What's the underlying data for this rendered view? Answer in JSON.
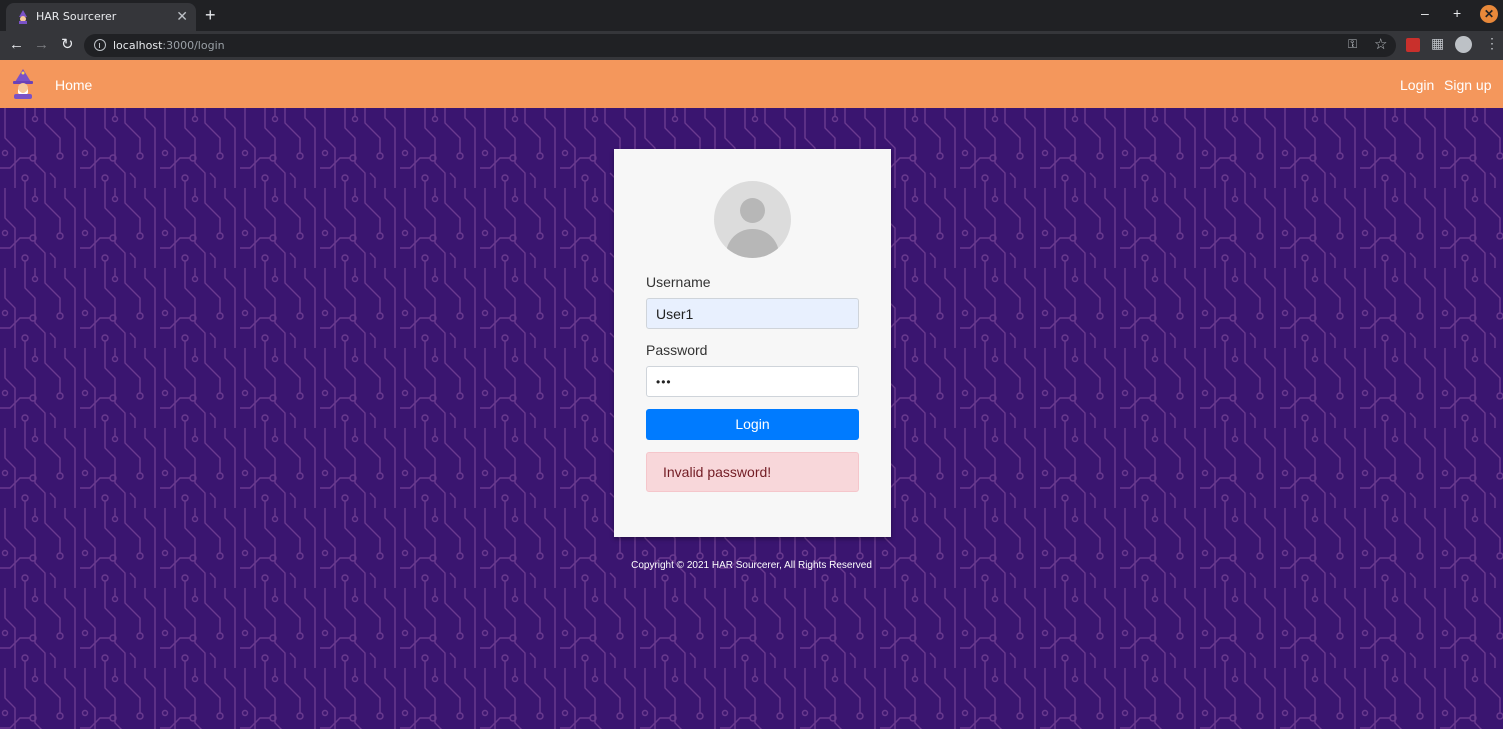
{
  "browser": {
    "tab_title": "HAR Sourcerer",
    "tab_close": "✕",
    "new_tab": "+",
    "url_host": "localhost",
    "url_path": ":3000/login",
    "window_min": "–",
    "window_max": "+",
    "window_close": "✕"
  },
  "navbar": {
    "home_label": "Home",
    "login_label": "Login",
    "signup_label": "Sign up",
    "background_color": "#f4975c"
  },
  "login_form": {
    "username_label": "Username",
    "username_value": "User1",
    "password_label": "Password",
    "password_value": "abc",
    "submit_label": "Login",
    "error_message": "Invalid password!",
    "button_color": "#007bff",
    "alert_color": "#f8d7da"
  },
  "footer": {
    "copyright": "Copyright © 2021 HAR Sourcerer, All Rights Reserved"
  },
  "theme": {
    "page_background": "#3a1570",
    "circuit_line": "#6a3a8f"
  },
  "icons": {
    "tab_favicon": "wizard-icon",
    "brand_logo": "wizard-icon",
    "back": "arrow-left-icon",
    "forward": "arrow-right-icon",
    "reload": "reload-icon",
    "site_info": "info-icon",
    "password_key": "key-icon",
    "bookmark": "star-icon",
    "extensions": "puzzle-icon",
    "profile": "account-icon",
    "menu": "kebab-menu-icon",
    "avatar": "user-avatar-icon"
  }
}
